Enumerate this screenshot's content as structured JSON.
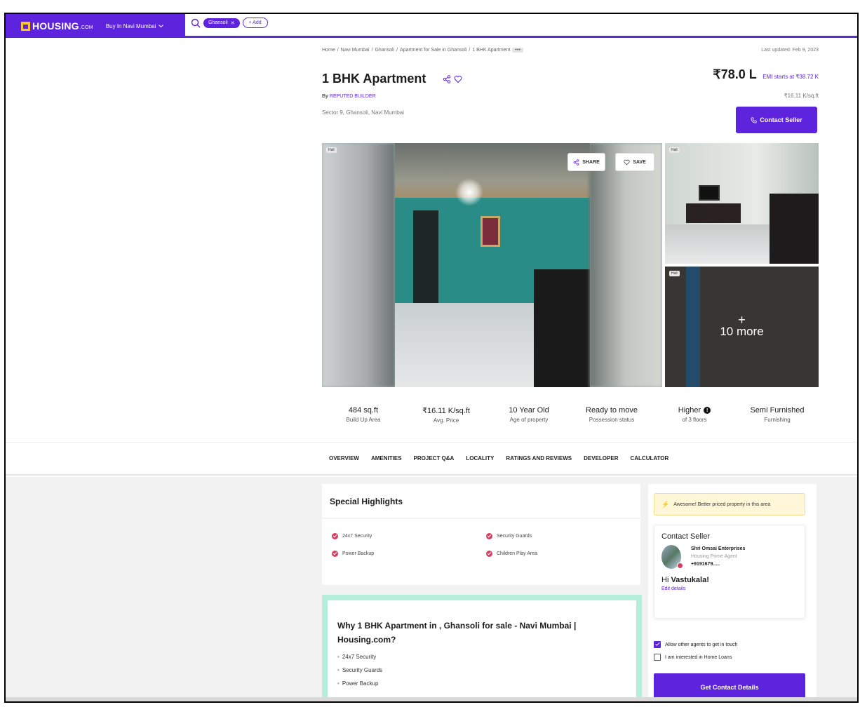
{
  "nav": {
    "logo": "HOUSING",
    "logo_suffix": ".COM",
    "city_menu": "Buy In Navi Mumbai",
    "search_chip": "Ghansoli",
    "add_label": "+ Add"
  },
  "breadcrumb": {
    "items": [
      "Home",
      "Navi Mumbai",
      "Ghansoli",
      "Apartment for Sale in Ghansoli",
      "1 BHK Apartment"
    ],
    "more": "•••"
  },
  "last_updated": "Last updated: Feb 9, 2023",
  "listing": {
    "title": "1 BHK Apartment",
    "by_prefix": "By",
    "builder": "REPUTED BUILDER",
    "location": "Sector 9, Ghansoli, Navi Mumbai",
    "price": "₹78.0 L",
    "emi": "EMI starts at ₹38.72 K",
    "price_per_sqft": "₹16.11 K/sq.ft",
    "contact_button": "Contact Seller"
  },
  "gallery": {
    "main_tag": "Hall",
    "side_top_tag": "Hall",
    "side_bottom_tag": "Hall",
    "share_label": "SHARE",
    "save_label": "SAVE",
    "more_plus": "+",
    "more_label": "10 more"
  },
  "stats": [
    {
      "value": "484 sq.ft",
      "label": "Build Up Area"
    },
    {
      "value": "₹16.11 K/sq.ft",
      "label": "Avg. Price"
    },
    {
      "value": "10 Year Old",
      "label": "Age of property"
    },
    {
      "value": "Ready to move",
      "label": "Possession status"
    },
    {
      "value": "Higher",
      "label": "of 3 floors"
    },
    {
      "value": "Semi Furnished",
      "label": "Furnishing"
    }
  ],
  "tabs": [
    "OVERVIEW",
    "AMENITIES",
    "PROJECT Q&A",
    "LOCALITY",
    "RATINGS AND REVIEWS",
    "DEVELOPER",
    "CALCULATOR"
  ],
  "highlights": {
    "title": "Special Highlights",
    "items": [
      "24x7 Security",
      "Security Guards",
      "Power Backup",
      "Children Play Area"
    ]
  },
  "why": {
    "title": "Why 1 BHK Apartment in , Ghansoli for sale - Navi Mumbai | Housing.com?",
    "items": [
      "24x7 Security",
      "Security Guards",
      "Power Backup"
    ]
  },
  "sidebar": {
    "awesome": "Awesome! Better priced property in this area",
    "contact_title": "Contact Seller",
    "agent_name": "Shri Omsai Enterprises",
    "agent_tag": "Housing Prime Agent",
    "agent_phone": "+9191679.....",
    "greeting": "Hi",
    "user": "Vastukala!",
    "edit": "Edit details",
    "opt_agents": "Allow other agents to get in touch",
    "opt_loans": "I am interested in Home Loans",
    "get_details": "Get Contact Details"
  },
  "colors": {
    "brand": "#5e23dc",
    "check": "#d23f62",
    "why_border": "#b5eedb"
  }
}
